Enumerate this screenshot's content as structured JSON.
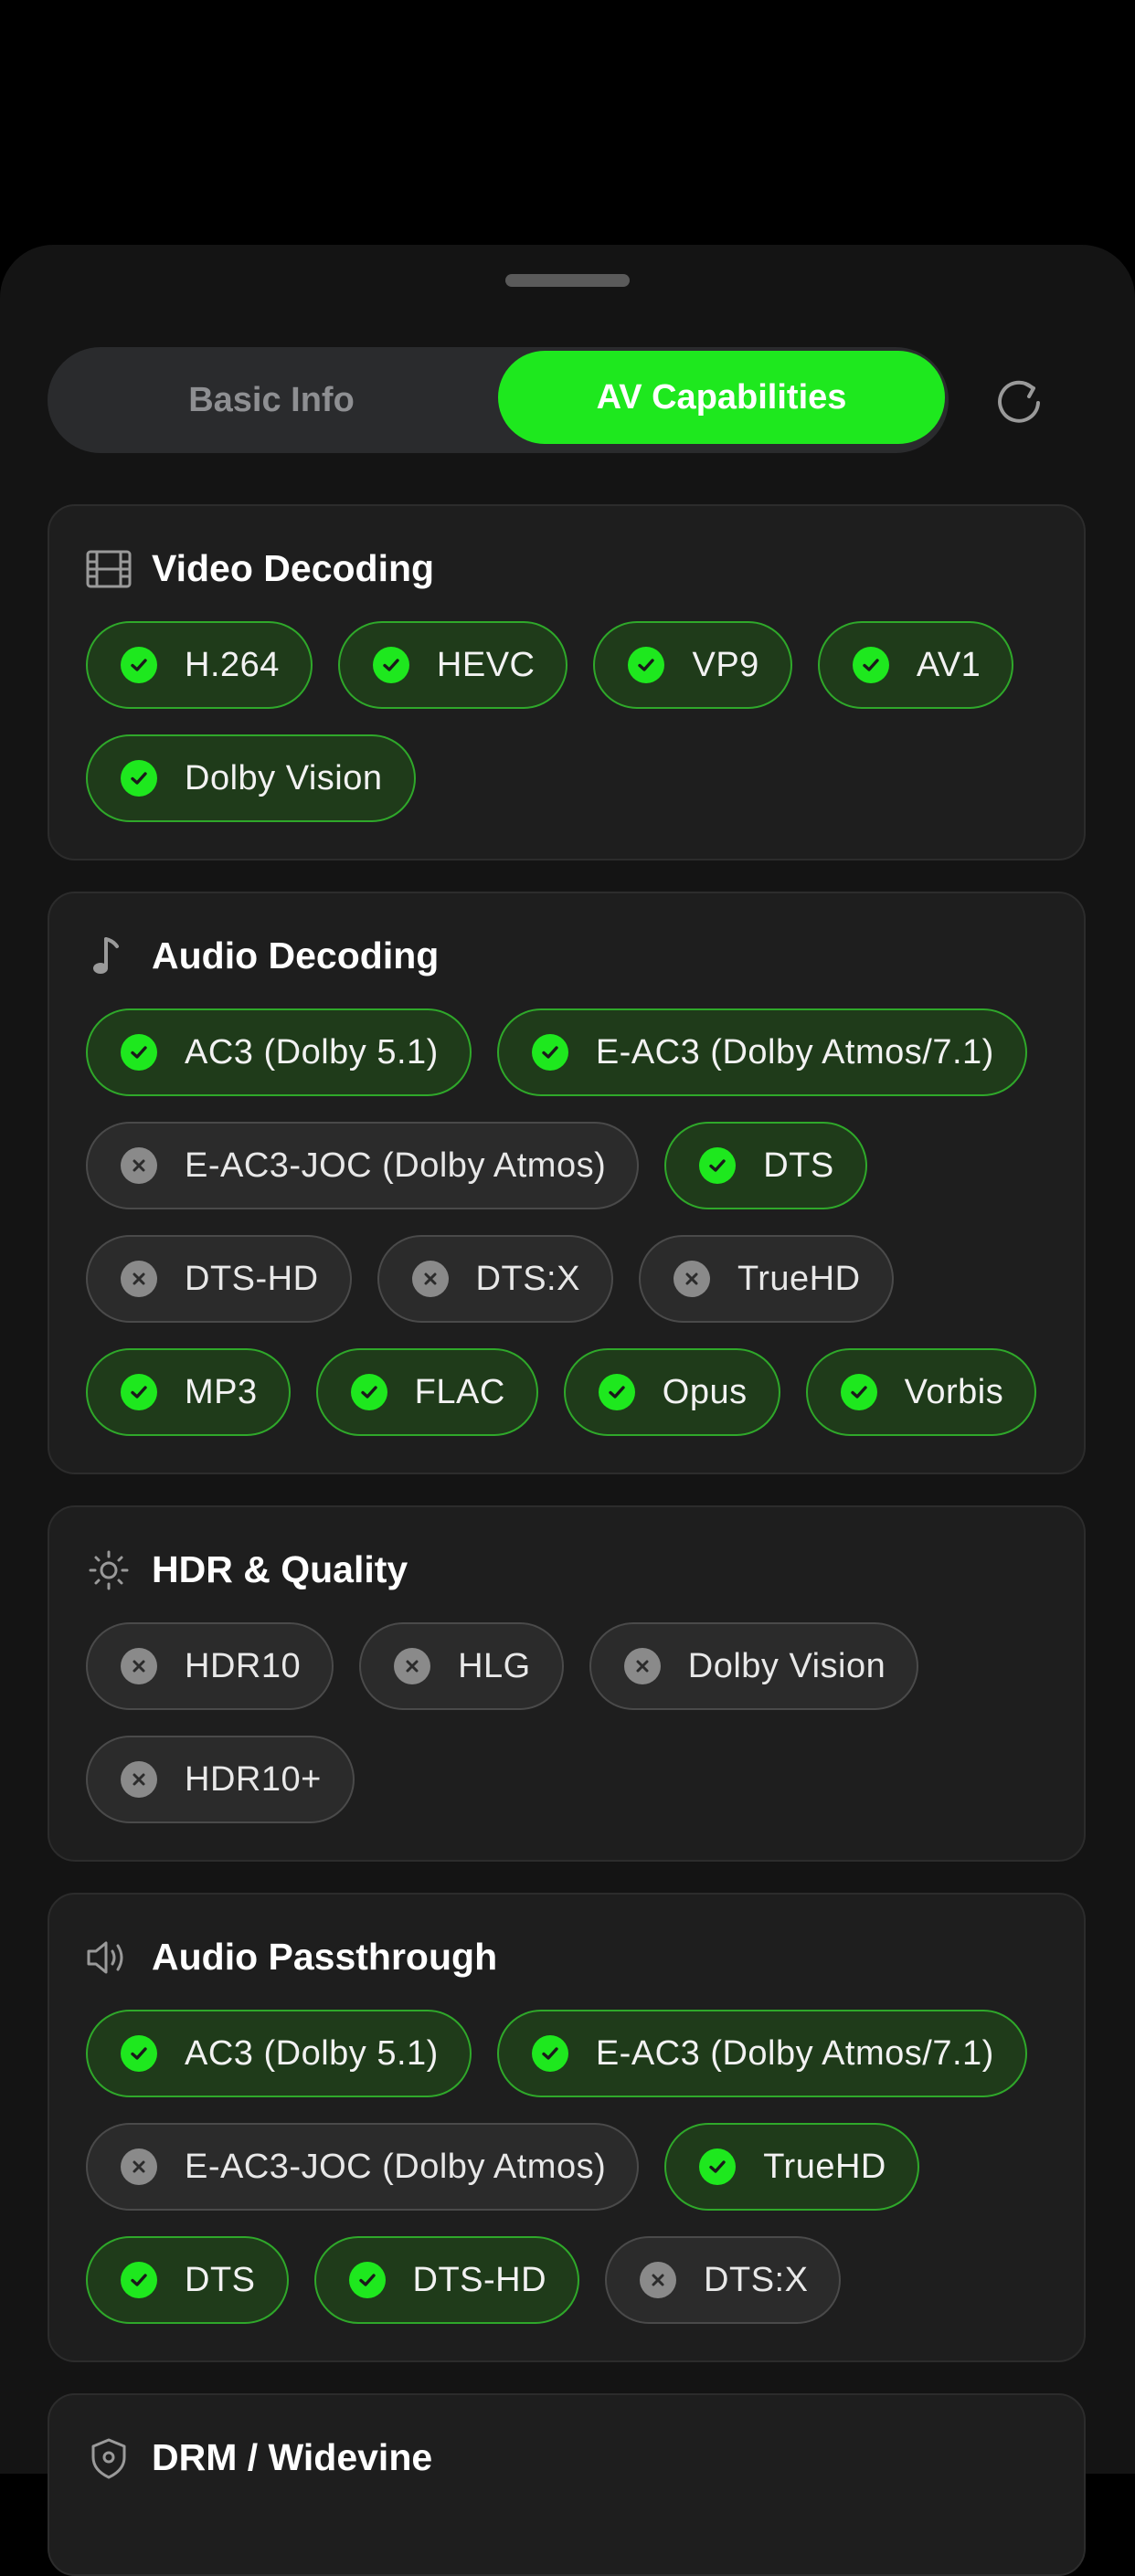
{
  "tabs": {
    "basic": "Basic Info",
    "av": "AV Capabilities"
  },
  "colors": {
    "accent": "#1EE81E",
    "supported": "#2FA82A",
    "unsupported": "#8A8A8A"
  },
  "sections": [
    {
      "title": "Video Decoding",
      "icon": "film-icon",
      "rows": [
        [
          {
            "label": "H.264",
            "supported": true
          },
          {
            "label": "HEVC",
            "supported": true
          },
          {
            "label": "VP9",
            "supported": true
          },
          {
            "label": "AV1",
            "supported": true
          }
        ],
        [
          {
            "label": "Dolby Vision",
            "supported": true
          }
        ]
      ]
    },
    {
      "title": "Audio Decoding",
      "icon": "music-note-icon",
      "rows": [
        [
          {
            "label": "AC3 (Dolby 5.1)",
            "supported": true
          },
          {
            "label": "E-AC3 (Dolby Atmos/7.1)",
            "supported": true
          }
        ],
        [
          {
            "label": "E-AC3-JOC (Dolby Atmos)",
            "supported": false
          },
          {
            "label": "DTS",
            "supported": true
          }
        ],
        [
          {
            "label": "DTS-HD",
            "supported": false
          },
          {
            "label": "DTS:X",
            "supported": false
          },
          {
            "label": "TrueHD",
            "supported": false
          }
        ],
        [
          {
            "label": "MP3",
            "supported": true
          },
          {
            "label": "FLAC",
            "supported": true
          },
          {
            "label": "Opus",
            "supported": true
          },
          {
            "label": "Vorbis",
            "supported": true
          }
        ]
      ]
    },
    {
      "title": "HDR & Quality",
      "icon": "sun-icon",
      "rows": [
        [
          {
            "label": "HDR10",
            "supported": false
          },
          {
            "label": "HLG",
            "supported": false
          },
          {
            "label": "Dolby Vision",
            "supported": false
          }
        ],
        [
          {
            "label": "HDR10+",
            "supported": false
          }
        ]
      ]
    },
    {
      "title": "Audio Passthrough",
      "icon": "speaker-icon",
      "rows": [
        [
          {
            "label": "AC3 (Dolby 5.1)",
            "supported": true
          },
          {
            "label": "E-AC3 (Dolby Atmos/7.1)",
            "supported": true
          }
        ],
        [
          {
            "label": "E-AC3-JOC (Dolby Atmos)",
            "supported": false
          },
          {
            "label": "TrueHD",
            "supported": true
          }
        ],
        [
          {
            "label": "DTS",
            "supported": true
          },
          {
            "label": "DTS-HD",
            "supported": true
          },
          {
            "label": "DTS:X",
            "supported": false
          }
        ]
      ]
    },
    {
      "title": "DRM / Widevine",
      "icon": "shield-icon",
      "rows": []
    }
  ]
}
